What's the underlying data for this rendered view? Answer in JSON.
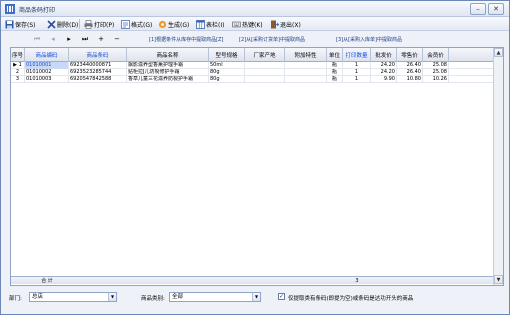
{
  "window": {
    "title": "商品条码打印"
  },
  "toolbar": {
    "save": "保存(S)",
    "delete": "删除(D)",
    "print": "打印(P)",
    "format": "格式(G)",
    "generate": "生成(G)",
    "columns": "表栏(I)",
    "hotkeys": "热键(K)",
    "exit": "退出(X)"
  },
  "nav": {
    "link1": "[1]根据条件从库存中提取商品[Z]",
    "link2": "[2]从[采购订货单]中提取商品",
    "link3": "[3]从[采购入库单]中提取商品"
  },
  "grid": {
    "headers": [
      "序号",
      "商品编码",
      "商品条码",
      "商品名称",
      "型号规格",
      "厂家产地",
      "附加特性",
      "单位",
      "打印数量",
      "批发价",
      "零售价",
      "会员价"
    ],
    "rows": [
      {
        "seq": "1",
        "code": "01010001",
        "barcode": "6923440000871",
        "name": "飘影滋养型香薰护理手霜",
        "spec": "50ml",
        "maker": "",
        "extra": "",
        "unit": "瓶",
        "qty": "1",
        "wholesale": "24.20",
        "retail": "26.40",
        "member": "25.08"
      },
      {
        "seq": "2",
        "code": "01010002",
        "barcode": "6923523285744",
        "name": "贴柜拉J儿防裂修护手霜",
        "spec": "80g",
        "maker": "",
        "extra": "",
        "unit": "瓶",
        "qty": "1",
        "wholesale": "24.20",
        "retail": "26.40",
        "member": "25.08"
      },
      {
        "seq": "3",
        "code": "01010003",
        "barcode": "6920547842588",
        "name": "香草儿童三花滋养防裂护手霜",
        "spec": "80g",
        "maker": "",
        "extra": "",
        "unit": "瓶",
        "qty": "1",
        "wholesale": "9.90",
        "retail": "10.80",
        "member": "10.26"
      }
    ],
    "total_label": "合 计",
    "total_qty": "3"
  },
  "bottom": {
    "dept_label": "部门:",
    "dept_value": "总店",
    "category_label": "商品类别:",
    "category_value": "全部",
    "option_text": "仅提取类有条码(即提为空)或条码是达功开头的商品"
  },
  "colors": {
    "accent": "#1a4fd6",
    "frame": "#6c87b8",
    "selection": "#c7d9f5"
  }
}
